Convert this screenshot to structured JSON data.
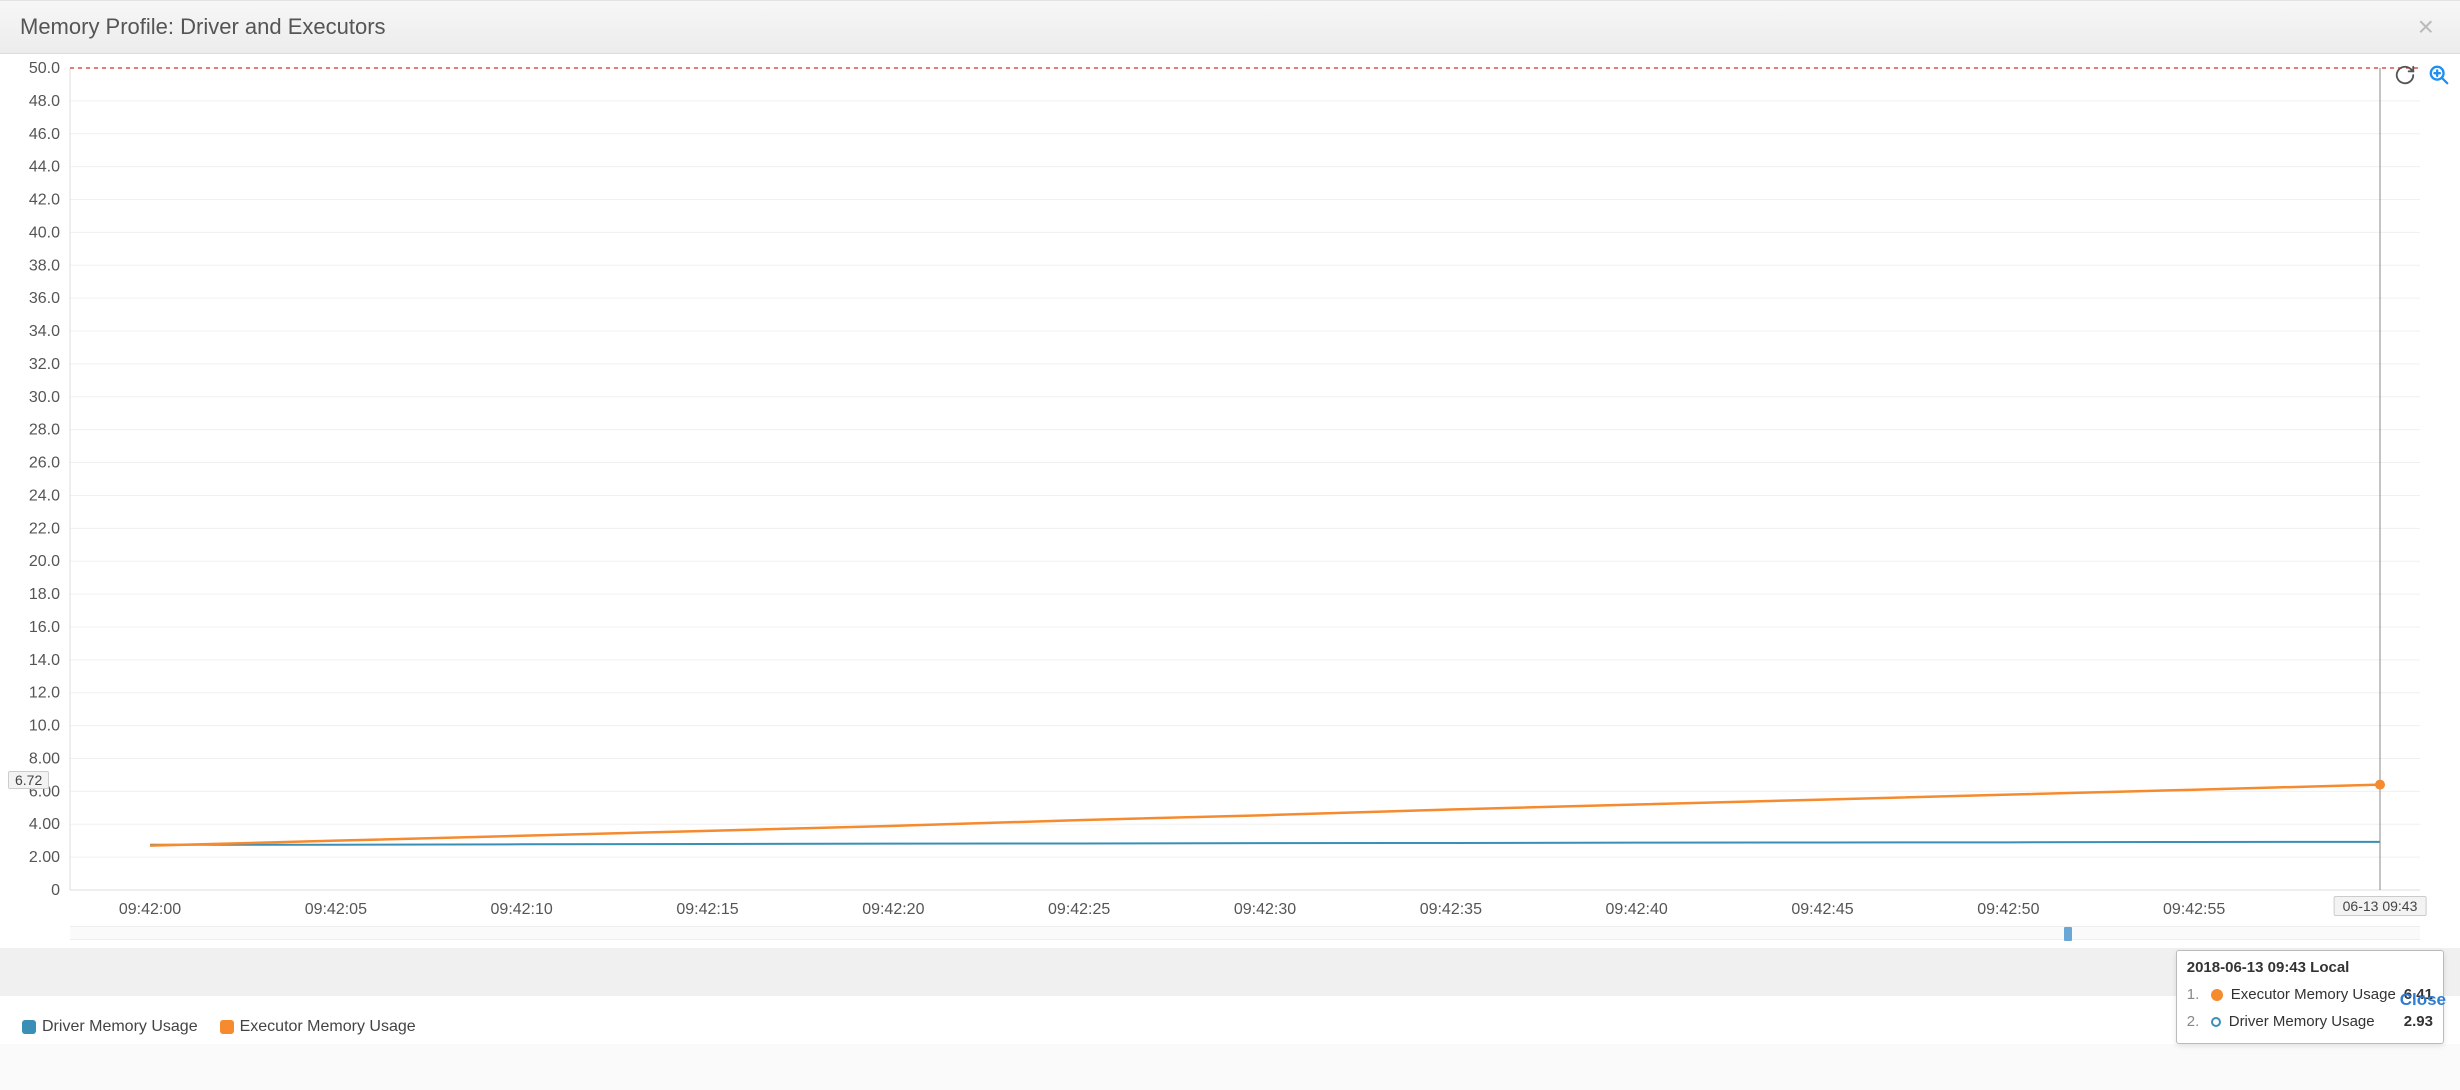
{
  "header": {
    "title": "Memory Profile: Driver and Executors",
    "close_symbol": "×"
  },
  "toolbar": {
    "refresh_name": "refresh-icon",
    "zoom_name": "zoom-in-icon"
  },
  "legend": {
    "items": [
      {
        "label": "Driver Memory Usage",
        "color": "#3a8fb7"
      },
      {
        "label": "Executor Memory Usage",
        "color": "#f58b2e"
      }
    ]
  },
  "hover": {
    "x_flag": "06-13 09:43",
    "y_flag": "6.72",
    "tooltip_header": "2018-06-13 09:43 Local",
    "rows": [
      {
        "idx": "1.",
        "style": "filled",
        "label": "Executor Memory Usage",
        "value": "6.41"
      },
      {
        "idx": "2.",
        "style": "open",
        "label": "Driver Memory Usage",
        "value": "2.93"
      }
    ]
  },
  "close_link": "Close",
  "chart_data": {
    "type": "line",
    "title": "Memory Profile: Driver and Executors",
    "xlabel": "",
    "ylabel": "",
    "x_ticks": [
      "09:42:00",
      "09:42:05",
      "09:42:10",
      "09:42:15",
      "09:42:20",
      "09:42:25",
      "09:42:30",
      "09:42:35",
      "09:42:40",
      "09:42:45",
      "09:42:50",
      "09:42:55"
    ],
    "ylim": [
      0,
      50
    ],
    "y_ticks": [
      0,
      2.0,
      4.0,
      6.0,
      8.0,
      10.0,
      12.0,
      14.0,
      16.0,
      18.0,
      20.0,
      22.0,
      24.0,
      26.0,
      28.0,
      30.0,
      32.0,
      34.0,
      36.0,
      38.0,
      40.0,
      42.0,
      44.0,
      46.0,
      48.0,
      50.0
    ],
    "reference_line": 50.0,
    "hover_x_index": 12,
    "series": [
      {
        "name": "Driver Memory Usage",
        "color": "#3a8fb7",
        "x": [
          "09:42:00",
          "09:42:05",
          "09:42:10",
          "09:42:15",
          "09:42:20",
          "09:42:25",
          "09:42:30",
          "09:42:35",
          "09:42:40",
          "09:42:45",
          "09:42:50",
          "09:42:55",
          "09:43:00"
        ],
        "values": [
          2.75,
          2.75,
          2.78,
          2.8,
          2.82,
          2.83,
          2.85,
          2.86,
          2.88,
          2.89,
          2.9,
          2.92,
          2.93
        ]
      },
      {
        "name": "Executor Memory Usage",
        "color": "#f58b2e",
        "x": [
          "09:42:00",
          "09:42:05",
          "09:42:10",
          "09:42:15",
          "09:42:20",
          "09:42:25",
          "09:42:30",
          "09:42:35",
          "09:42:40",
          "09:42:45",
          "09:42:50",
          "09:42:55",
          "09:43:00"
        ],
        "values": [
          2.7,
          3.0,
          3.3,
          3.6,
          3.9,
          4.25,
          4.55,
          4.9,
          5.2,
          5.5,
          5.8,
          6.1,
          6.41
        ]
      }
    ]
  }
}
